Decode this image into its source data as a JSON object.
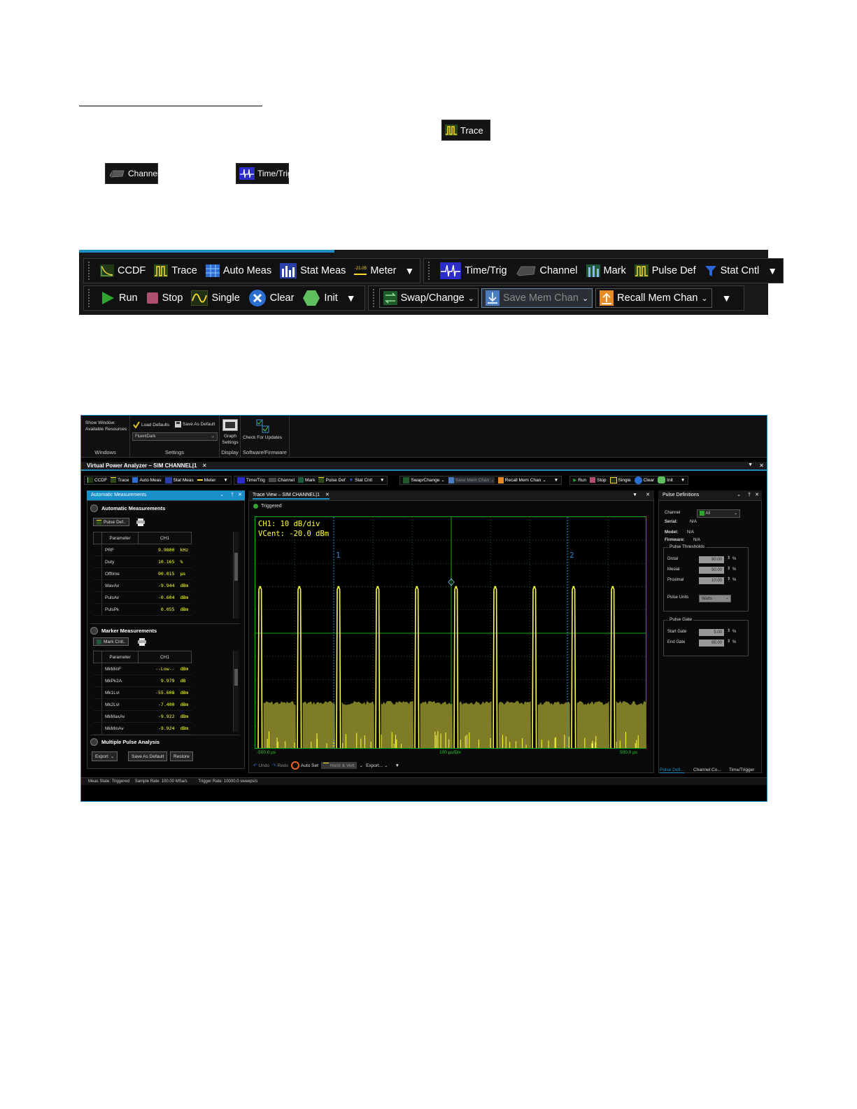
{
  "inline_buttons": {
    "trace": "Trace",
    "channel": "Channel",
    "time_trig": "Time/Trig"
  },
  "toolbar_large": {
    "row1_group1": [
      "CCDF",
      "Trace",
      "Auto Meas",
      "Stat Meas",
      "Meter"
    ],
    "meter_small": "-21.05",
    "row1_group2": [
      "Time/Trig",
      "Channel",
      "Mark",
      "Pulse Def",
      "Stat Cntl"
    ],
    "row2_group1": [
      "Run",
      "Stop",
      "Single",
      "Clear",
      "Init"
    ],
    "row2_group2": [
      "Swap/Change",
      "Save Mem Chan",
      "Recall Mem Chan"
    ]
  },
  "ribbon": {
    "show_window": "Show Window:",
    "available_resources": "Available Resources",
    "windows_caption": "Windows",
    "load_defaults": "Load Defaults",
    "save_as_default": "Save As Default",
    "theme_value": "FluentDark",
    "settings_caption": "Settings",
    "graph_settings_1": "Graph",
    "graph_settings_2": "Settings",
    "display_caption": "Display",
    "check_updates": "Check For Updates",
    "software_caption": "Software/Firmware"
  },
  "app": {
    "title": "Virtual Power Analyzer – SIM CHANNEL|1",
    "small_toolbar": {
      "g1": [
        "CCDF",
        "Trace",
        "Auto Meas",
        "Stat Meas",
        "Meter"
      ],
      "g2": [
        "Time/Trig",
        "Channel",
        "Mark",
        "Pulse Def",
        "Stat Cntl"
      ],
      "g3": [
        "Swap/Change",
        "Save Mem Chan",
        "Recall Mem Chan"
      ],
      "g4": [
        "Run",
        "Stop",
        "Single",
        "Clear",
        "Init"
      ]
    },
    "auto_meas": {
      "panel_title": "Automatic Measurements",
      "section_title": "Automatic Measurements",
      "pulse_def_button": "Pulse Def..",
      "col_param": "Parameter",
      "col_ch": "CH1",
      "rows": [
        {
          "p": "PRF",
          "v": "9.9800",
          "u": "kHz"
        },
        {
          "p": "Duty",
          "v": "10.165",
          "u": "%"
        },
        {
          "p": "Offtime",
          "v": "90.015",
          "u": "µs"
        },
        {
          "p": "WavAv",
          "v": "-9.944",
          "u": "dBm"
        },
        {
          "p": "PulsAv",
          "v": "-0.604",
          "u": "dBm"
        },
        {
          "p": "PulsPk",
          "v": "0.055",
          "u": "dBm"
        }
      ],
      "marker_title": "Marker Measurements",
      "mark_cntl_button": "Mark Cntl..",
      "marker_rows": [
        {
          "p": "MkMinF",
          "v": "--Low--",
          "u": "dBm"
        },
        {
          "p": "MkPk2A",
          "v": "9.979",
          "u": "dB"
        },
        {
          "p": "Mk1Lvl",
          "v": "-55.608",
          "u": "dBm"
        },
        {
          "p": "Mk2Lvl",
          "v": "-7.400",
          "u": "dBm"
        },
        {
          "p": "MkMaxAv",
          "v": "-9.922",
          "u": "dBm"
        },
        {
          "p": "MkMinAv",
          "v": "-9.924",
          "u": "dBm"
        }
      ],
      "multi_pulse_title": "Multiple Pulse Analysis",
      "export_btn": "Export",
      "save_default_btn": "Save As Default",
      "restore_btn": "Restore"
    },
    "trace_view": {
      "tab": "Trace View – SIM CHANNEL|1",
      "triggered": "Triggered",
      "scale": "CH1: 10 dB/div",
      "vcent": "VCent: -20.0 dBm",
      "marker1": "1",
      "marker2": "2",
      "x_left": "-500.0 µs",
      "x_mid": "100 µs/Div",
      "x_right": "500.0 µs",
      "undo": "Undo",
      "redo": "Redo",
      "auto_set": "Auto Set",
      "horiz_vert": "Horiz & Vert",
      "export": "Export..."
    },
    "pulse_def": {
      "panel_title": "Pulse Definitions",
      "channel_label": "Channel",
      "channel_value": "All",
      "serial_label": "Serial:",
      "serial_value": "N/A",
      "model_label": "Model:",
      "model_value": "N/A",
      "firmware_label": "Firmware:",
      "firmware_value": "N/A",
      "thresholds_title": "Pulse Thresholds",
      "distal_label": "Distal",
      "distal_value": "90.00",
      "mesial_label": "Mesial",
      "mesial_value": "50.00",
      "proximal_label": "Proximal",
      "proximal_value": "10.00",
      "pct": "%",
      "units_label": "Pulse Units",
      "units_value": "Watts",
      "gate_title": "Pulse Gate",
      "start_label": "Start Gate",
      "start_value": "5.00",
      "end_label": "End Gate",
      "end_value": "95.00",
      "tabs": [
        "Pulse Defi...",
        "Channel Co...",
        "Time/Trigger"
      ]
    },
    "status": {
      "meas_state": "Meas State: Triggered",
      "sample_rate": "Sample Rate: 100.00 MSa/s",
      "trigger_rate": "Trigger Rate: 10000.0 sweeps/s"
    }
  },
  "chart_data": {
    "type": "line",
    "title": "",
    "xlabel": "100 µs/Div",
    "ylabel": "",
    "xlim": [
      -500,
      500
    ],
    "x_unit": "µs",
    "ylim": [
      -70,
      30
    ],
    "y_unit": "dBm",
    "pulse_count": 10,
    "series": [
      {
        "name": "CH1",
        "pulse_peak": 0.055,
        "noise_floor": -50
      }
    ],
    "markers": [
      {
        "label": "1"
      },
      {
        "label": "2"
      }
    ]
  }
}
